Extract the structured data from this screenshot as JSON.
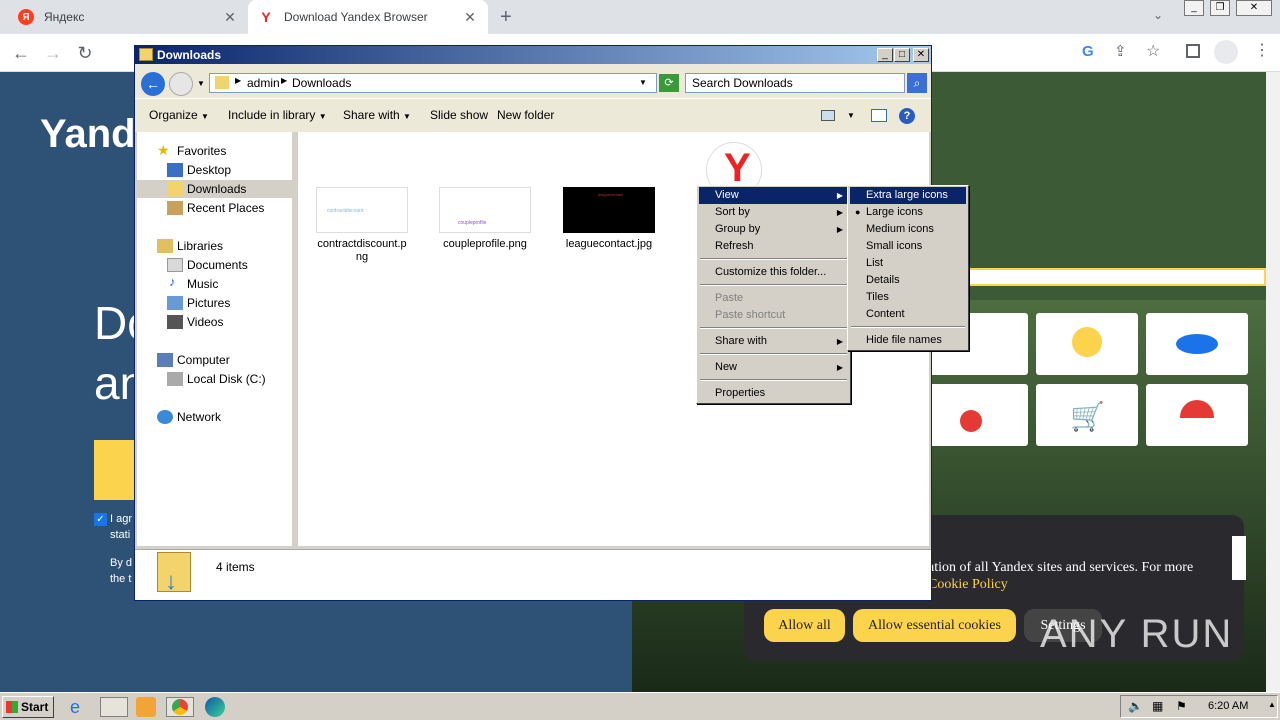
{
  "browser": {
    "tabs": [
      {
        "title": "Яндекс",
        "favicon": "yandex-favicon"
      },
      {
        "title": "Download Yandex Browser",
        "favicon": "yandex-browser-favicon"
      }
    ]
  },
  "page": {
    "logo": "Yande",
    "headline_line1": "Do",
    "headline_line2": "an",
    "agree_text": "I agr",
    "agree_text2": "stati",
    "by_text": "By d",
    "by_text2": "the t",
    "cookie": {
      "text_line1": "ation of all Yandex sites and services. For more",
      "link": "Cookie Policy",
      "buttons": [
        "Allow all",
        "Allow essential cookies",
        "Settings"
      ]
    },
    "watermark": "ANY RUN"
  },
  "explorer": {
    "title": "Downloads",
    "breadcrumb": [
      "admin",
      "Downloads"
    ],
    "search_placeholder": "Search Downloads",
    "commands": [
      "Organize",
      "Include in library",
      "Share with",
      "Slide show",
      "New folder"
    ],
    "nav": {
      "favorites_header": "Favorites",
      "favorites": [
        "Desktop",
        "Downloads",
        "Recent Places"
      ],
      "libraries_header": "Libraries",
      "libraries": [
        "Documents",
        "Music",
        "Pictures",
        "Videos"
      ],
      "computer_header": "Computer",
      "computer": [
        "Local Disk (C:)"
      ],
      "network_header": "Network"
    },
    "files": [
      {
        "name1": "contractdiscount.p",
        "name2": "ng",
        "thumb_text": "contractdiscount"
      },
      {
        "name1": "coupleprofile.png",
        "name2": "",
        "thumb_text": "coupleprofile"
      },
      {
        "name1": "leaguecontact.jpg",
        "name2": "",
        "thumb_text": "leaguecontact"
      }
    ],
    "status_text": "4 items"
  },
  "context_menu": {
    "items": [
      {
        "label": "View",
        "submenu": true,
        "highlighted": true
      },
      {
        "label": "Sort by",
        "submenu": true
      },
      {
        "label": "Group by",
        "submenu": true
      },
      {
        "label": "Refresh"
      },
      {
        "label": "Customize this folder..."
      },
      {
        "label": "Paste",
        "disabled": true
      },
      {
        "label": "Paste shortcut",
        "disabled": true
      },
      {
        "label": "Share with",
        "submenu": true
      },
      {
        "label": "New",
        "submenu": true
      },
      {
        "label": "Properties"
      }
    ]
  },
  "view_submenu": {
    "items": [
      "Extra large icons",
      "Large icons",
      "Medium icons",
      "Small icons",
      "List",
      "Details",
      "Tiles",
      "Content",
      "Hide file names"
    ],
    "highlighted": "Extra large icons",
    "selected": "Large icons"
  },
  "taskbar": {
    "start_label": "Start",
    "clock": "6:20 AM"
  },
  "colors": {
    "xp_title": "#0a246a",
    "menu_highlight": "#0a246a",
    "cookie_button": "#fcd34d"
  }
}
